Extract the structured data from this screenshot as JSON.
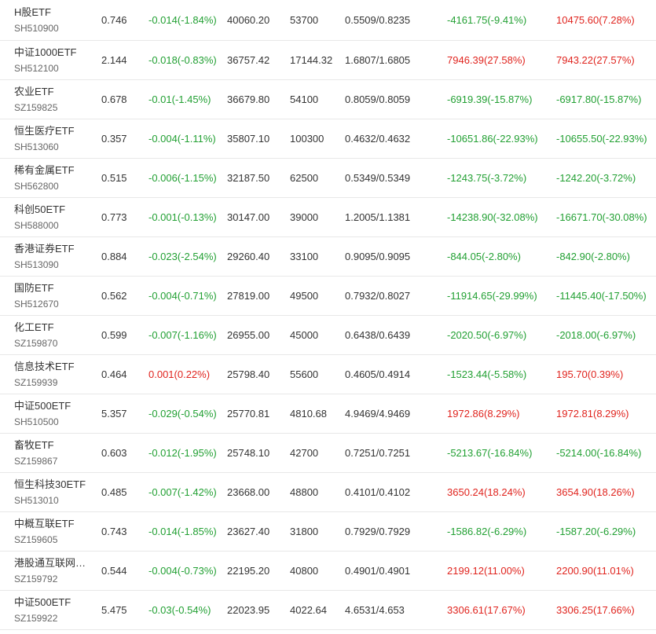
{
  "rows": [
    {
      "name": "H股ETF",
      "code": "SH510900",
      "price": "0.746",
      "change": "-0.014(-1.84%)",
      "change_dir": "down",
      "scale": "40060.20",
      "shares": "53700",
      "nav": "0.5509/0.8235",
      "flow1": "-4161.75(-9.41%)",
      "flow1_dir": "down",
      "flow2": "10475.60(7.28%)",
      "flow2_dir": "up"
    },
    {
      "name": "中证1000ETF",
      "code": "SH512100",
      "price": "2.144",
      "change": "-0.018(-0.83%)",
      "change_dir": "down",
      "scale": "36757.42",
      "shares": "17144.32",
      "nav": "1.6807/1.6805",
      "flow1": "7946.39(27.58%)",
      "flow1_dir": "up",
      "flow2": "7943.22(27.57%)",
      "flow2_dir": "up"
    },
    {
      "name": "农业ETF",
      "code": "SZ159825",
      "price": "0.678",
      "change": "-0.01(-1.45%)",
      "change_dir": "down",
      "scale": "36679.80",
      "shares": "54100",
      "nav": "0.8059/0.8059",
      "flow1": "-6919.39(-15.87%)",
      "flow1_dir": "down",
      "flow2": "-6917.80(-15.87%)",
      "flow2_dir": "down"
    },
    {
      "name": "恒生医疗ETF",
      "code": "SH513060",
      "price": "0.357",
      "change": "-0.004(-1.11%)",
      "change_dir": "down",
      "scale": "35807.10",
      "shares": "100300",
      "nav": "0.4632/0.4632",
      "flow1": "-10651.86(-22.93%)",
      "flow1_dir": "down",
      "flow2": "-10655.50(-22.93%)",
      "flow2_dir": "down"
    },
    {
      "name": "稀有金属ETF",
      "code": "SH562800",
      "price": "0.515",
      "change": "-0.006(-1.15%)",
      "change_dir": "down",
      "scale": "32187.50",
      "shares": "62500",
      "nav": "0.5349/0.5349",
      "flow1": "-1243.75(-3.72%)",
      "flow1_dir": "down",
      "flow2": "-1242.20(-3.72%)",
      "flow2_dir": "down"
    },
    {
      "name": "科创50ETF",
      "code": "SH588000",
      "price": "0.773",
      "change": "-0.001(-0.13%)",
      "change_dir": "down",
      "scale": "30147.00",
      "shares": "39000",
      "nav": "1.2005/1.1381",
      "flow1": "-14238.90(-32.08%)",
      "flow1_dir": "down",
      "flow2": "-16671.70(-30.08%)",
      "flow2_dir": "down"
    },
    {
      "name": "香港证券ETF",
      "code": "SH513090",
      "price": "0.884",
      "change": "-0.023(-2.54%)",
      "change_dir": "down",
      "scale": "29260.40",
      "shares": "33100",
      "nav": "0.9095/0.9095",
      "flow1": "-844.05(-2.80%)",
      "flow1_dir": "down",
      "flow2": "-842.90(-2.80%)",
      "flow2_dir": "down"
    },
    {
      "name": "国防ETF",
      "code": "SH512670",
      "price": "0.562",
      "change": "-0.004(-0.71%)",
      "change_dir": "down",
      "scale": "27819.00",
      "shares": "49500",
      "nav": "0.7932/0.8027",
      "flow1": "-11914.65(-29.99%)",
      "flow1_dir": "down",
      "flow2": "-11445.40(-17.50%)",
      "flow2_dir": "down"
    },
    {
      "name": "化工ETF",
      "code": "SZ159870",
      "price": "0.599",
      "change": "-0.007(-1.16%)",
      "change_dir": "down",
      "scale": "26955.00",
      "shares": "45000",
      "nav": "0.6438/0.6439",
      "flow1": "-2020.50(-6.97%)",
      "flow1_dir": "down",
      "flow2": "-2018.00(-6.97%)",
      "flow2_dir": "down"
    },
    {
      "name": "信息技术ETF",
      "code": "SZ159939",
      "price": "0.464",
      "change": "0.001(0.22%)",
      "change_dir": "up",
      "scale": "25798.40",
      "shares": "55600",
      "nav": "0.4605/0.4914",
      "flow1": "-1523.44(-5.58%)",
      "flow1_dir": "down",
      "flow2": "195.70(0.39%)",
      "flow2_dir": "up"
    },
    {
      "name": "中证500ETF",
      "code": "SH510500",
      "price": "5.357",
      "change": "-0.029(-0.54%)",
      "change_dir": "down",
      "scale": "25770.81",
      "shares": "4810.68",
      "nav": "4.9469/4.9469",
      "flow1": "1972.86(8.29%)",
      "flow1_dir": "up",
      "flow2": "1972.81(8.29%)",
      "flow2_dir": "up"
    },
    {
      "name": "畜牧ETF",
      "code": "SZ159867",
      "price": "0.603",
      "change": "-0.012(-1.95%)",
      "change_dir": "down",
      "scale": "25748.10",
      "shares": "42700",
      "nav": "0.7251/0.7251",
      "flow1": "-5213.67(-16.84%)",
      "flow1_dir": "down",
      "flow2": "-5214.00(-16.84%)",
      "flow2_dir": "down"
    },
    {
      "name": "恒生科技30ETF",
      "code": "SH513010",
      "price": "0.485",
      "change": "-0.007(-1.42%)",
      "change_dir": "down",
      "scale": "23668.00",
      "shares": "48800",
      "nav": "0.4101/0.4102",
      "flow1": "3650.24(18.24%)",
      "flow1_dir": "up",
      "flow2": "3654.90(18.26%)",
      "flow2_dir": "up"
    },
    {
      "name": "中概互联ETF",
      "code": "SZ159605",
      "price": "0.743",
      "change": "-0.014(-1.85%)",
      "change_dir": "down",
      "scale": "23627.40",
      "shares": "31800",
      "nav": "0.7929/0.7929",
      "flow1": "-1586.82(-6.29%)",
      "flow1_dir": "down",
      "flow2": "-1587.20(-6.29%)",
      "flow2_dir": "down"
    },
    {
      "name": "港股通互联网…",
      "code": "SZ159792",
      "price": "0.544",
      "change": "-0.004(-0.73%)",
      "change_dir": "down",
      "scale": "22195.20",
      "shares": "40800",
      "nav": "0.4901/0.4901",
      "flow1": "2199.12(11.00%)",
      "flow1_dir": "up",
      "flow2": "2200.90(11.01%)",
      "flow2_dir": "up"
    },
    {
      "name": "中证500ETF",
      "code": "SZ159922",
      "price": "5.475",
      "change": "-0.03(-0.54%)",
      "change_dir": "down",
      "scale": "22023.95",
      "shares": "4022.64",
      "nav": "4.6531/4.653",
      "flow1": "3306.61(17.67%)",
      "flow1_dir": "up",
      "flow2": "3306.25(17.66%)",
      "flow2_dir": "up"
    }
  ]
}
